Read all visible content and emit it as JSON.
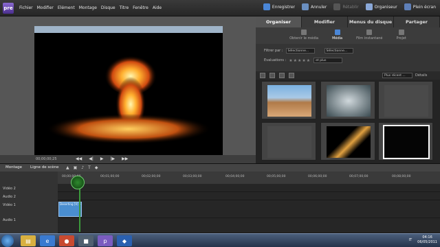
{
  "app": {
    "logo": "pre"
  },
  "menu": [
    "Fichier",
    "Modifier",
    "Elément",
    "Montage",
    "Disque",
    "Titre",
    "Fenêtre",
    "Aide"
  ],
  "toolbar": [
    {
      "label": "Enregistrer",
      "icon": "save-icon",
      "disabled": false
    },
    {
      "label": "Annuler",
      "icon": "undo-icon",
      "disabled": false
    },
    {
      "label": "Rétablir",
      "icon": "redo-icon",
      "disabled": true
    },
    {
      "label": "Organiseur",
      "icon": "organizer-icon",
      "disabled": false
    },
    {
      "label": "Plein écran",
      "icon": "fullscreen-icon",
      "disabled": false
    }
  ],
  "preview": {
    "timecode": "00;00;00;25"
  },
  "panel_tabs": [
    "Organiser",
    "Modifier",
    "Menus du disque",
    "Partager"
  ],
  "sub_tabs": [
    "Obtenir le média",
    "Média",
    "Film instantané",
    "Projet"
  ],
  "filters": {
    "filter_label": "Filtrer par :",
    "select_1": "Sélectionne...",
    "select_2": "Sélectionne...",
    "ratings_label": "Evaluations :",
    "ratings_mode": "et plus",
    "sort": "Plus récent ...",
    "details": "Détails"
  },
  "timeline_tabs": [
    "Montage",
    "Ligne de scène"
  ],
  "timeline": {
    "ruler": [
      "00;00;00;00",
      "00;01;00;00",
      "00;02;00;00",
      "00;03;00;00",
      "00;04;00;00",
      "00;05;00;00",
      "00;06;00;00",
      "00;07;00;00",
      "00;08;00;00"
    ],
    "tracks": [
      "Vidéo 2",
      "Audio 2",
      "Vidéo 1",
      "Audio 1"
    ],
    "clip_label": "Deserting [V] +"
  },
  "taskbar": {
    "lang": "IT",
    "time": "04:16",
    "date": "06/05/2011"
  },
  "colors": {
    "accent": "#4a86d6",
    "playhead": "#3c9a3c",
    "clip": "#4a8ed0"
  }
}
